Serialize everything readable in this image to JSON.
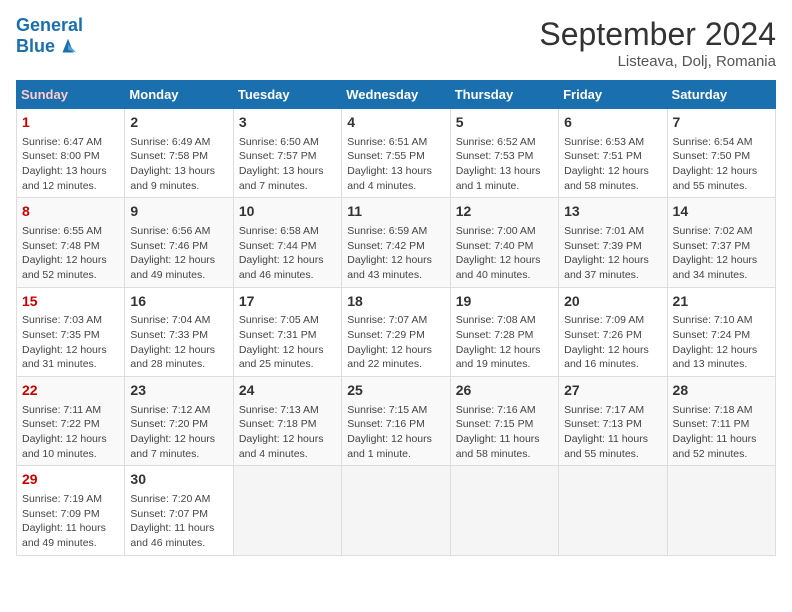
{
  "logo": {
    "line1": "General",
    "line2": "Blue"
  },
  "title": "September 2024",
  "subtitle": "Listeava, Dolj, Romania",
  "days_of_week": [
    "Sunday",
    "Monday",
    "Tuesday",
    "Wednesday",
    "Thursday",
    "Friday",
    "Saturday"
  ],
  "weeks": [
    [
      {
        "day": "1",
        "sunrise": "6:47 AM",
        "sunset": "8:00 PM",
        "daylight": "13 hours and 12 minutes."
      },
      {
        "day": "2",
        "sunrise": "6:49 AM",
        "sunset": "7:58 PM",
        "daylight": "13 hours and 9 minutes."
      },
      {
        "day": "3",
        "sunrise": "6:50 AM",
        "sunset": "7:57 PM",
        "daylight": "13 hours and 7 minutes."
      },
      {
        "day": "4",
        "sunrise": "6:51 AM",
        "sunset": "7:55 PM",
        "daylight": "13 hours and 4 minutes."
      },
      {
        "day": "5",
        "sunrise": "6:52 AM",
        "sunset": "7:53 PM",
        "daylight": "13 hours and 1 minute."
      },
      {
        "day": "6",
        "sunrise": "6:53 AM",
        "sunset": "7:51 PM",
        "daylight": "12 hours and 58 minutes."
      },
      {
        "day": "7",
        "sunrise": "6:54 AM",
        "sunset": "7:50 PM",
        "daylight": "12 hours and 55 minutes."
      }
    ],
    [
      {
        "day": "8",
        "sunrise": "6:55 AM",
        "sunset": "7:48 PM",
        "daylight": "12 hours and 52 minutes."
      },
      {
        "day": "9",
        "sunrise": "6:56 AM",
        "sunset": "7:46 PM",
        "daylight": "12 hours and 49 minutes."
      },
      {
        "day": "10",
        "sunrise": "6:58 AM",
        "sunset": "7:44 PM",
        "daylight": "12 hours and 46 minutes."
      },
      {
        "day": "11",
        "sunrise": "6:59 AM",
        "sunset": "7:42 PM",
        "daylight": "12 hours and 43 minutes."
      },
      {
        "day": "12",
        "sunrise": "7:00 AM",
        "sunset": "7:40 PM",
        "daylight": "12 hours and 40 minutes."
      },
      {
        "day": "13",
        "sunrise": "7:01 AM",
        "sunset": "7:39 PM",
        "daylight": "12 hours and 37 minutes."
      },
      {
        "day": "14",
        "sunrise": "7:02 AM",
        "sunset": "7:37 PM",
        "daylight": "12 hours and 34 minutes."
      }
    ],
    [
      {
        "day": "15",
        "sunrise": "7:03 AM",
        "sunset": "7:35 PM",
        "daylight": "12 hours and 31 minutes."
      },
      {
        "day": "16",
        "sunrise": "7:04 AM",
        "sunset": "7:33 PM",
        "daylight": "12 hours and 28 minutes."
      },
      {
        "day": "17",
        "sunrise": "7:05 AM",
        "sunset": "7:31 PM",
        "daylight": "12 hours and 25 minutes."
      },
      {
        "day": "18",
        "sunrise": "7:07 AM",
        "sunset": "7:29 PM",
        "daylight": "12 hours and 22 minutes."
      },
      {
        "day": "19",
        "sunrise": "7:08 AM",
        "sunset": "7:28 PM",
        "daylight": "12 hours and 19 minutes."
      },
      {
        "day": "20",
        "sunrise": "7:09 AM",
        "sunset": "7:26 PM",
        "daylight": "12 hours and 16 minutes."
      },
      {
        "day": "21",
        "sunrise": "7:10 AM",
        "sunset": "7:24 PM",
        "daylight": "12 hours and 13 minutes."
      }
    ],
    [
      {
        "day": "22",
        "sunrise": "7:11 AM",
        "sunset": "7:22 PM",
        "daylight": "12 hours and 10 minutes."
      },
      {
        "day": "23",
        "sunrise": "7:12 AM",
        "sunset": "7:20 PM",
        "daylight": "12 hours and 7 minutes."
      },
      {
        "day": "24",
        "sunrise": "7:13 AM",
        "sunset": "7:18 PM",
        "daylight": "12 hours and 4 minutes."
      },
      {
        "day": "25",
        "sunrise": "7:15 AM",
        "sunset": "7:16 PM",
        "daylight": "12 hours and 1 minute."
      },
      {
        "day": "26",
        "sunrise": "7:16 AM",
        "sunset": "7:15 PM",
        "daylight": "11 hours and 58 minutes."
      },
      {
        "day": "27",
        "sunrise": "7:17 AM",
        "sunset": "7:13 PM",
        "daylight": "11 hours and 55 minutes."
      },
      {
        "day": "28",
        "sunrise": "7:18 AM",
        "sunset": "7:11 PM",
        "daylight": "11 hours and 52 minutes."
      }
    ],
    [
      {
        "day": "29",
        "sunrise": "7:19 AM",
        "sunset": "7:09 PM",
        "daylight": "11 hours and 49 minutes."
      },
      {
        "day": "30",
        "sunrise": "7:20 AM",
        "sunset": "7:07 PM",
        "daylight": "11 hours and 46 minutes."
      },
      null,
      null,
      null,
      null,
      null
    ]
  ],
  "labels": {
    "sunrise": "Sunrise:",
    "sunset": "Sunset:",
    "daylight": "Daylight:"
  },
  "colors": {
    "header_bg": "#1a6faf",
    "sunday_color": "#cc0000"
  }
}
